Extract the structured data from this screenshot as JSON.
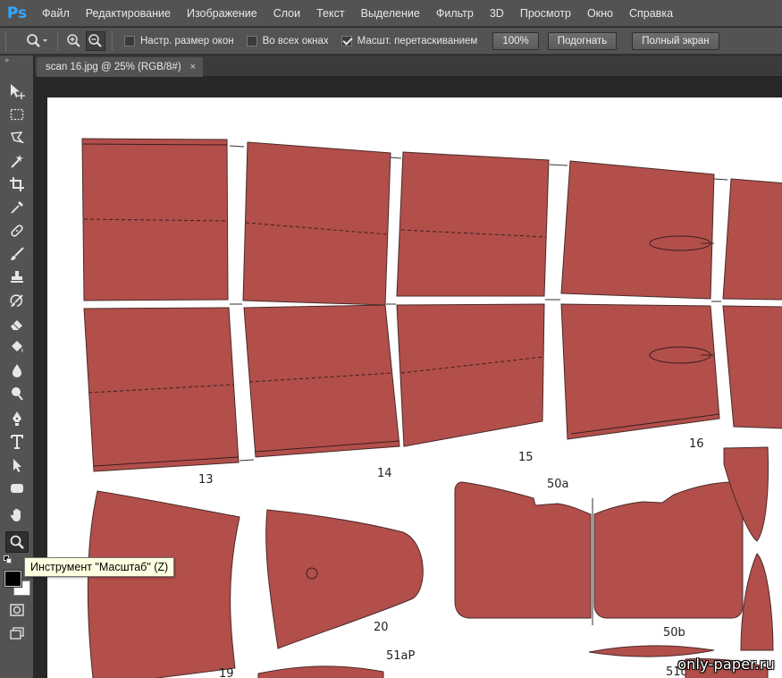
{
  "app": {
    "logo": "Ps",
    "menu": [
      "Файл",
      "Редактирование",
      "Изображение",
      "Слои",
      "Текст",
      "Выделение",
      "Фильтр",
      "3D",
      "Просмотр",
      "Окно",
      "Справка"
    ]
  },
  "options": {
    "tool_preset_icon": "zoom-icon",
    "zoom_in_icon": "zoom-in-icon",
    "zoom_out_icon": "zoom-out-icon",
    "checkboxes": [
      {
        "label": "Настр. размер окон",
        "checked": false
      },
      {
        "label": "Во всех окнах",
        "checked": false
      },
      {
        "label": "Масшт. перетаскиванием",
        "checked": true
      }
    ],
    "buttons": [
      "100%",
      "Подогнать",
      "Полный экран"
    ]
  },
  "toolbox": {
    "tools": [
      "move-icon",
      "marquee-icon",
      "lasso-icon",
      "magic-wand-icon",
      "crop-icon",
      "eyedropper-icon",
      "healing-brush-icon",
      "brush-icon",
      "clone-stamp-icon",
      "history-brush-icon",
      "eraser-icon",
      "paint-bucket-icon",
      "blur-icon",
      "dodge-icon",
      "pen-icon",
      "type-icon",
      "path-selection-icon",
      "shape-icon",
      "hand-icon",
      "zoom-icon"
    ],
    "active_tool": "zoom-icon",
    "foreground_color": "#000000",
    "background_color": "#ffffff"
  },
  "document": {
    "tab_title": "scan 16.jpg @ 25% (RGB/8#)",
    "close_glyph": "×",
    "paper_color": "#ffffff",
    "part_color": "#b24f4a",
    "part_numbers": [
      "13",
      "14",
      "15",
      "16",
      "50a",
      "20",
      "19",
      "51aP",
      "50b",
      "51c"
    ]
  },
  "tooltip": {
    "text": "Инструмент \"Масштаб\" (Z)"
  },
  "watermark": {
    "text": "only-paper.ru"
  }
}
